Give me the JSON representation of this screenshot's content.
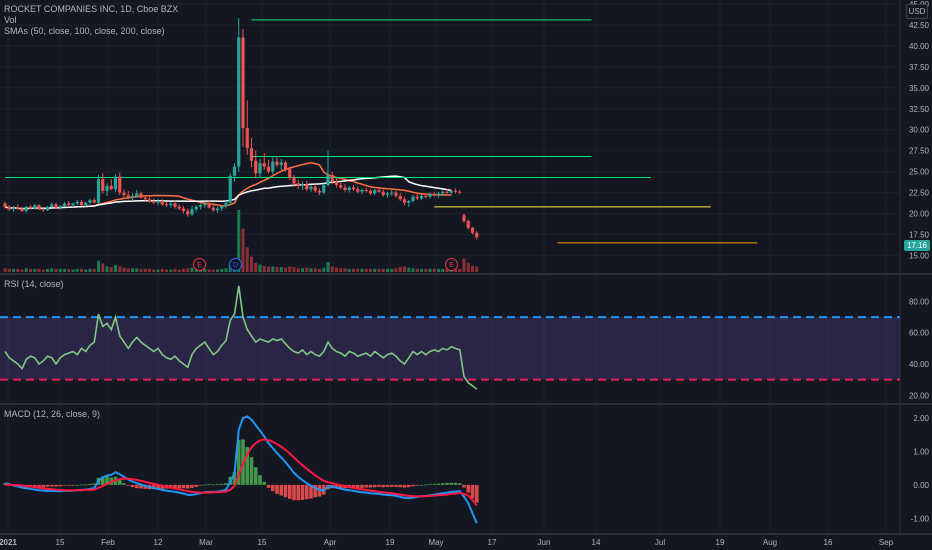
{
  "header": {
    "title": "ROCKET COMPANIES INC, 1D, Cboe BZX",
    "vol_label": "Vol",
    "sma_label": "SMAs (50, close, 100, close, 200, close)",
    "currency": "USD"
  },
  "rsi_panel": {
    "label": "RSI (14, close)"
  },
  "macd_panel": {
    "label": "MACD (12, 26, close, 9)"
  },
  "badges": {
    "earnings_1": "E",
    "dividend": "D",
    "earnings_2": "E",
    "price": "17.16"
  },
  "colors": {
    "background": "#131722",
    "grid": "#1e222d",
    "up": "#26a69a",
    "down": "#ef5350",
    "sma50": "#ff7043",
    "sma100": "#ffffff",
    "rsi_line": "#81c784",
    "rsi_band": "#7e57c2",
    "rsi_upper": "#2196f3",
    "rsi_lower": "#e91e63",
    "macd_line": "#2196f3",
    "signal_line": "#ff1744",
    "line_green": "#00e676",
    "line_yellow": "#ffeb3b",
    "line_orange": "#ff9800"
  },
  "chart_data": [
    {
      "type": "candlestick",
      "title": "ROCKET COMPANIES INC, 1D, Cboe BZX",
      "y_unit": "USD",
      "ylim": [
        13.5,
        45
      ],
      "y_ticks": [
        "15.00",
        "17.50",
        "20.00",
        "22.50",
        "25.00",
        "27.50",
        "30.00",
        "32.50",
        "35.00",
        "37.50",
        "40.00",
        "42.50",
        "45.00"
      ],
      "x_ticks": [
        "2021",
        "15",
        "Feb",
        "12",
        "Mar",
        "15",
        "Apr",
        "19",
        "May",
        "17",
        "Jun",
        "14",
        "Jul",
        "19",
        "Aug",
        "16",
        "Sep"
      ],
      "last_price": 17.16,
      "horizontal_lines": [
        {
          "price": 43.1,
          "color": "green",
          "from_day": 58,
          "to_day": 138
        },
        {
          "price": 26.8,
          "color": "green",
          "from_day": 58,
          "to_day": 138
        },
        {
          "price": 24.3,
          "color": "green",
          "from_day": 0,
          "to_day": 152
        },
        {
          "price": 20.8,
          "color": "yellow",
          "from_day": 101,
          "to_day": 166
        },
        {
          "price": 16.5,
          "color": "orange",
          "from_day": 130,
          "to_day": 177
        }
      ],
      "candles": [
        [
          21.2,
          21.4,
          20.6,
          20.8
        ],
        [
          20.8,
          21.0,
          20.3,
          20.5
        ],
        [
          20.5,
          20.9,
          20.2,
          20.7
        ],
        [
          20.7,
          21.1,
          20.4,
          20.6
        ],
        [
          20.6,
          20.8,
          20.2,
          20.3
        ],
        [
          20.3,
          20.9,
          20.1,
          20.8
        ],
        [
          20.8,
          21.0,
          20.5,
          20.6
        ],
        [
          20.6,
          21.2,
          20.5,
          21.0
        ],
        [
          21.0,
          21.1,
          20.4,
          20.5
        ],
        [
          20.5,
          20.7,
          20.2,
          20.4
        ],
        [
          20.4,
          20.9,
          20.3,
          20.8
        ],
        [
          20.8,
          21.3,
          20.7,
          21.1
        ],
        [
          21.1,
          21.3,
          20.6,
          20.7
        ],
        [
          20.7,
          21.0,
          20.5,
          20.9
        ],
        [
          20.9,
          21.4,
          20.8,
          21.2
        ],
        [
          21.2,
          21.5,
          20.9,
          21.0
        ],
        [
          21.0,
          21.3,
          20.7,
          21.2
        ],
        [
          21.2,
          21.6,
          21.0,
          21.4
        ],
        [
          21.4,
          21.6,
          20.9,
          21.0
        ],
        [
          21.0,
          21.4,
          20.8,
          21.3
        ],
        [
          21.3,
          21.8,
          21.1,
          21.6
        ],
        [
          21.6,
          21.9,
          21.2,
          21.3
        ],
        [
          21.3,
          24.6,
          21.2,
          24.1
        ],
        [
          24.1,
          24.8,
          22.4,
          22.7
        ],
        [
          22.7,
          23.6,
          22.1,
          23.3
        ],
        [
          23.3,
          24.1,
          22.8,
          22.9
        ],
        [
          22.9,
          24.7,
          22.6,
          24.4
        ],
        [
          24.4,
          24.9,
          22.2,
          22.5
        ],
        [
          22.5,
          22.9,
          21.9,
          22.2
        ],
        [
          22.2,
          22.7,
          21.7,
          21.9
        ],
        [
          21.9,
          22.4,
          21.5,
          22.1
        ],
        [
          22.1,
          22.8,
          21.9,
          22.4
        ],
        [
          22.4,
          22.6,
          21.8,
          21.9
        ],
        [
          21.9,
          22.2,
          21.5,
          21.7
        ],
        [
          21.7,
          22.0,
          21.3,
          21.5
        ],
        [
          21.5,
          21.8,
          21.1,
          21.3
        ],
        [
          21.3,
          21.7,
          21.0,
          21.5
        ],
        [
          21.5,
          21.7,
          20.9,
          21.1
        ],
        [
          21.1,
          21.4,
          20.8,
          21.0
        ],
        [
          21.0,
          21.4,
          20.7,
          21.2
        ],
        [
          21.2,
          21.5,
          20.6,
          20.8
        ],
        [
          20.8,
          21.1,
          20.4,
          20.6
        ],
        [
          20.6,
          20.9,
          20.0,
          20.3
        ],
        [
          20.3,
          20.6,
          19.6,
          19.9
        ],
        [
          19.9,
          20.9,
          19.7,
          20.5
        ],
        [
          20.5,
          21.0,
          20.2,
          20.8
        ],
        [
          20.8,
          21.2,
          20.5,
          21.0
        ],
        [
          21.0,
          21.4,
          20.7,
          21.2
        ],
        [
          21.2,
          21.5,
          20.6,
          20.7
        ],
        [
          20.7,
          21.0,
          20.2,
          20.4
        ],
        [
          20.4,
          20.8,
          20.1,
          20.6
        ],
        [
          20.6,
          21.0,
          20.3,
          20.9
        ],
        [
          20.9,
          21.5,
          20.6,
          21.3
        ],
        [
          21.3,
          24.8,
          21.0,
          24.5
        ],
        [
          24.5,
          26.0,
          23.8,
          25.6
        ],
        [
          25.6,
          43.3,
          25.0,
          41.0
        ],
        [
          41.0,
          42.0,
          28.0,
          30.2
        ],
        [
          30.2,
          33.5,
          27.0,
          27.8
        ],
        [
          27.8,
          29.0,
          25.5,
          26.3
        ],
        [
          26.3,
          27.5,
          24.2,
          24.8
        ],
        [
          24.8,
          26.5,
          24.3,
          26.0
        ],
        [
          26.0,
          27.2,
          25.2,
          25.6
        ],
        [
          25.6,
          26.4,
          24.8,
          25.0
        ],
        [
          25.0,
          26.7,
          24.7,
          26.2
        ],
        [
          26.2,
          26.8,
          25.5,
          25.8
        ],
        [
          25.8,
          26.5,
          25.2,
          26.1
        ],
        [
          26.1,
          26.3,
          25.0,
          25.3
        ],
        [
          25.3,
          25.6,
          24.0,
          24.3
        ],
        [
          24.3,
          24.6,
          23.2,
          23.6
        ],
        [
          23.6,
          24.0,
          22.9,
          23.3
        ],
        [
          23.3,
          23.8,
          22.8,
          23.5
        ],
        [
          23.5,
          23.9,
          22.7,
          22.9
        ],
        [
          22.9,
          23.4,
          22.6,
          23.2
        ],
        [
          23.2,
          23.5,
          22.5,
          22.7
        ],
        [
          22.7,
          23.0,
          22.2,
          22.5
        ],
        [
          22.5,
          23.6,
          22.3,
          23.4
        ],
        [
          23.4,
          27.5,
          23.2,
          24.6
        ],
        [
          24.6,
          25.0,
          23.5,
          23.8
        ],
        [
          23.8,
          24.2,
          23.1,
          23.4
        ],
        [
          23.4,
          23.8,
          22.9,
          23.1
        ],
        [
          23.1,
          23.5,
          22.6,
          22.8
        ],
        [
          22.8,
          23.3,
          22.5,
          23.1
        ],
        [
          23.1,
          23.4,
          22.7,
          22.9
        ],
        [
          22.9,
          23.2,
          22.4,
          22.6
        ],
        [
          22.6,
          23.0,
          22.3,
          22.8
        ],
        [
          22.8,
          23.1,
          22.5,
          22.7
        ],
        [
          22.7,
          22.9,
          22.2,
          22.4
        ],
        [
          22.4,
          22.9,
          22.2,
          22.8
        ],
        [
          22.8,
          23.2,
          22.5,
          22.6
        ],
        [
          22.6,
          22.9,
          22.0,
          22.2
        ],
        [
          22.2,
          22.6,
          21.9,
          22.4
        ],
        [
          22.4,
          22.8,
          22.1,
          22.5
        ],
        [
          22.5,
          22.7,
          21.9,
          22.1
        ],
        [
          22.1,
          22.4,
          21.5,
          21.7
        ],
        [
          21.7,
          22.0,
          21.0,
          21.3
        ],
        [
          21.3,
          21.6,
          20.8,
          21.5
        ],
        [
          21.5,
          22.2,
          21.3,
          22.0
        ],
        [
          22.0,
          22.3,
          21.6,
          21.8
        ],
        [
          21.8,
          22.3,
          21.6,
          22.1
        ],
        [
          22.1,
          22.4,
          21.8,
          22.0
        ],
        [
          22.0,
          22.5,
          21.8,
          22.3
        ],
        [
          22.3,
          22.6,
          22.0,
          22.2
        ],
        [
          22.2,
          22.6,
          21.9,
          22.4
        ],
        [
          22.4,
          22.8,
          22.1,
          22.6
        ],
        [
          22.6,
          22.9,
          22.3,
          22.5
        ],
        [
          22.5,
          22.8,
          22.2,
          22.7
        ],
        [
          22.7,
          23.0,
          22.4,
          22.6
        ],
        [
          22.6,
          22.8,
          22.3,
          22.5
        ],
        [
          19.8,
          20.0,
          18.9,
          19.1
        ],
        [
          19.1,
          19.3,
          18.1,
          18.3
        ],
        [
          18.3,
          18.4,
          17.5,
          17.7
        ],
        [
          17.7,
          17.9,
          16.9,
          17.16
        ]
      ],
      "volume": [
        6,
        5,
        5,
        5,
        4,
        6,
        5,
        5,
        5,
        4,
        5,
        6,
        5,
        5,
        5,
        5,
        4,
        5,
        5,
        4,
        5,
        5,
        18,
        14,
        9,
        8,
        11,
        9,
        7,
        6,
        6,
        6,
        5,
        5,
        5,
        4,
        4,
        5,
        4,
        4,
        5,
        4,
        5,
        6,
        7,
        5,
        5,
        5,
        4,
        4,
        4,
        5,
        6,
        14,
        20,
        100,
        70,
        40,
        25,
        15,
        12,
        10,
        9,
        9,
        8,
        8,
        7,
        9,
        8,
        6,
        6,
        7,
        6,
        6,
        5,
        7,
        16,
        9,
        7,
        6,
        6,
        5,
        5,
        5,
        5,
        5,
        5,
        5,
        5,
        5,
        5,
        5,
        6,
        8,
        9,
        7,
        6,
        5,
        5,
        5,
        5,
        5,
        5,
        5,
        5,
        5,
        5,
        5,
        22,
        15,
        10,
        9
      ]
    },
    {
      "type": "line",
      "title": "RSI (14, close)",
      "ylim": [
        17,
        95
      ],
      "y_ticks": [
        "20.00",
        "40.00",
        "60.00",
        "80.00"
      ],
      "upper_band": 70,
      "lower_band": 30,
      "values": [
        48,
        44,
        42,
        40,
        37,
        43,
        45,
        44,
        40,
        42,
        45,
        44,
        40,
        44,
        46,
        47,
        48,
        46,
        50,
        48,
        52,
        54,
        72,
        64,
        66,
        62,
        70,
        58,
        54,
        50,
        54,
        57,
        54,
        52,
        50,
        48,
        50,
        46,
        44,
        43,
        45,
        42,
        40,
        38,
        46,
        50,
        52,
        54,
        50,
        46,
        48,
        52,
        55,
        68,
        72,
        90,
        70,
        62,
        58,
        54,
        56,
        55,
        54,
        56,
        55,
        56,
        53,
        50,
        48,
        47,
        49,
        46,
        48,
        46,
        45,
        48,
        54,
        50,
        48,
        47,
        45,
        48,
        47,
        45,
        46,
        47,
        45,
        48,
        46,
        44,
        46,
        47,
        45,
        42,
        40,
        44,
        48,
        46,
        48,
        46,
        48,
        49,
        48,
        50,
        49,
        51,
        50,
        49,
        32,
        28,
        26,
        24
      ]
    },
    {
      "type": "line",
      "title": "MACD (12, 26, close, 9)",
      "ylim": [
        -1.35,
        2.3
      ],
      "y_ticks": [
        "-1.00",
        "0.00",
        "1.00",
        "2.00"
      ],
      "series": [
        {
          "values": [
            0.05,
            0.02,
            -0.02,
            -0.05,
            -0.08,
            -0.1,
            -0.12,
            -0.14,
            -0.16,
            -0.17,
            -0.18,
            -0.18,
            -0.19,
            -0.19,
            -0.18,
            -0.18,
            -0.17,
            -0.16,
            -0.15,
            -0.14,
            -0.12,
            -0.1,
            0.12,
            0.22,
            0.28,
            0.3,
            0.38,
            0.32,
            0.24,
            0.16,
            0.1,
            0.05,
            0.01,
            -0.03,
            -0.07,
            -0.1,
            -0.12,
            -0.15,
            -0.17,
            -0.19,
            -0.21,
            -0.23,
            -0.26,
            -0.3,
            -0.3,
            -0.28,
            -0.25,
            -0.22,
            -0.21,
            -0.21,
            -0.2,
            -0.18,
            -0.15,
            0.1,
            0.35,
            1.65,
            2.0,
            2.05,
            1.95,
            1.78,
            1.62,
            1.45,
            1.25,
            1.1,
            0.95,
            0.82,
            0.68,
            0.52,
            0.36,
            0.24,
            0.14,
            0.05,
            -0.03,
            -0.09,
            -0.15,
            -0.17,
            -0.05,
            -0.05,
            -0.08,
            -0.11,
            -0.14,
            -0.16,
            -0.18,
            -0.2,
            -0.22,
            -0.23,
            -0.25,
            -0.26,
            -0.27,
            -0.29,
            -0.3,
            -0.31,
            -0.33,
            -0.36,
            -0.39,
            -0.4,
            -0.38,
            -0.36,
            -0.34,
            -0.33,
            -0.31,
            -0.29,
            -0.27,
            -0.25,
            -0.23,
            -0.21,
            -0.2,
            -0.19,
            -0.35,
            -0.55,
            -0.85,
            -1.15
          ]
        },
        {
          "values": [
            0.0,
            0.0,
            0.0,
            -0.01,
            -0.02,
            -0.04,
            -0.05,
            -0.07,
            -0.09,
            -0.1,
            -0.12,
            -0.13,
            -0.14,
            -0.15,
            -0.16,
            -0.16,
            -0.16,
            -0.16,
            -0.16,
            -0.15,
            -0.15,
            -0.14,
            -0.09,
            -0.03,
            0.03,
            0.08,
            0.14,
            0.17,
            0.19,
            0.18,
            0.17,
            0.15,
            0.12,
            0.09,
            0.06,
            0.03,
            0.0,
            -0.03,
            -0.06,
            -0.08,
            -0.11,
            -0.13,
            -0.16,
            -0.19,
            -0.21,
            -0.22,
            -0.23,
            -0.23,
            -0.23,
            -0.22,
            -0.22,
            -0.21,
            -0.2,
            -0.14,
            -0.04,
            0.3,
            0.64,
            0.92,
            1.12,
            1.25,
            1.33,
            1.36,
            1.34,
            1.29,
            1.22,
            1.14,
            1.05,
            0.94,
            0.82,
            0.7,
            0.59,
            0.48,
            0.38,
            0.28,
            0.2,
            0.12,
            0.08,
            0.05,
            0.02,
            -0.01,
            -0.04,
            -0.06,
            -0.09,
            -0.11,
            -0.13,
            -0.15,
            -0.17,
            -0.19,
            -0.21,
            -0.22,
            -0.24,
            -0.25,
            -0.27,
            -0.29,
            -0.31,
            -0.33,
            -0.34,
            -0.34,
            -0.34,
            -0.34,
            -0.33,
            -0.32,
            -0.31,
            -0.3,
            -0.29,
            -0.27,
            -0.26,
            -0.24,
            -0.27,
            -0.32,
            -0.45,
            -0.62
          ]
        }
      ]
    }
  ]
}
